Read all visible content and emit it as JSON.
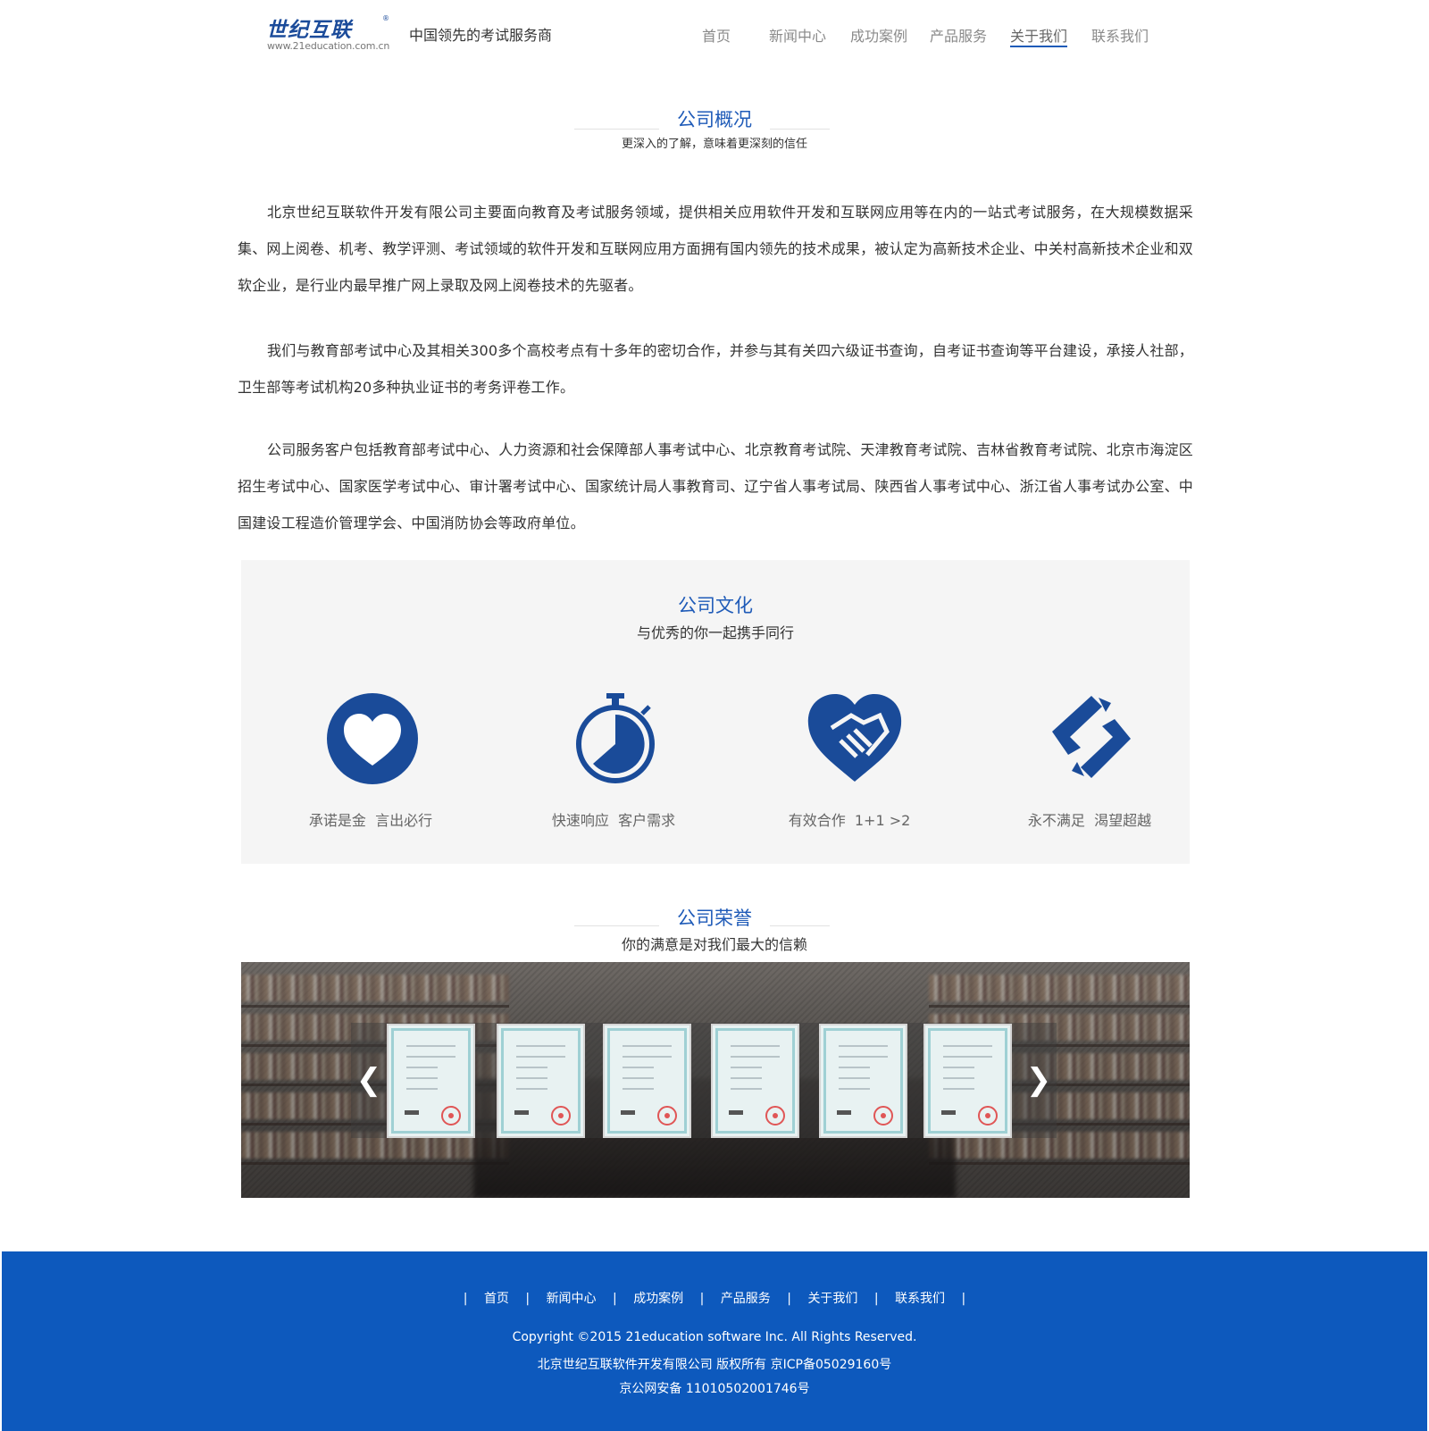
{
  "header": {
    "logo_text": "世纪互联",
    "logo_reg": "®",
    "logo_url": "www.21education.com.cn",
    "slogan": "中国领先的考试服务商",
    "nav": [
      "首页",
      "新闻中心",
      "成功案例",
      "产品服务",
      "关于我们",
      "联系我们"
    ],
    "active_nav": "关于我们"
  },
  "overview": {
    "title": "公司概况",
    "subtitle": "更深入的了解，意味着更深刻的信任",
    "paragraphs": [
      "北京世纪互联软件开发有限公司主要面向教育及考试服务领域，提供相关应用软件开发和互联网应用等在内的一站式考试服务，在大规模数据采集、网上阅卷、机考、教学评测、考试领域的软件开发和互联网应用方面拥有国内领先的技术成果，被认定为高新技术企业、中关村高新技术企业和双软企业，是行业内最早推广网上录取及网上阅卷技术的先驱者。",
      "我们与教育部考试中心及其相关300多个高校考点有十多年的密切合作，并参与其有关四六级证书查询，自考证书查询等平台建设，承接人社部，卫生部等考试机构20多种执业证书的考务评卷工作。",
      "公司服务客户包括教育部考试中心、人力资源和社会保障部人事考试中心、北京教育考试院、天津教育考试院、吉林省教育考试院、北京市海淀区招生考试中心、国家医学考试中心、审计署考试中心、国家统计局人事教育司、辽宁省人事考试局、陕西省人事考试中心、浙江省人事考试办公室、中国建设工程造价管理学会、中国消防协会等政府单位。"
    ]
  },
  "culture": {
    "title": "公司文化",
    "subtitle": "与优秀的你一起携手同行",
    "items": [
      {
        "icon": "heart-icon",
        "label": "承诺是金  言出必行"
      },
      {
        "icon": "stopwatch-icon",
        "label": "快速响应  客户需求"
      },
      {
        "icon": "handshake-icon",
        "label": "有效合作  1+1 >2"
      },
      {
        "icon": "link-arrows-icon",
        "label": "永不满足  渴望超越"
      }
    ],
    "accent": "#1a4b99"
  },
  "honors": {
    "title": "公司荣誉",
    "subtitle": "你的满意是对我们最大的信赖",
    "prev_label": "❮",
    "next_label": "❯",
    "certificate_count": 6
  },
  "footer": {
    "nav": [
      "首页",
      "新闻中心",
      "成功案例",
      "产品服务",
      "关于我们",
      "联系我们"
    ],
    "separator": "|",
    "copyright": "Copyright ©2015 21education software Inc. All Rights Reserved.",
    "company_line": "北京世纪互联软件开发有限公司 版权所有 京ICP备05029160号",
    "police_line": "京公网安备 11010502001746号",
    "background": "#0d59bd"
  }
}
